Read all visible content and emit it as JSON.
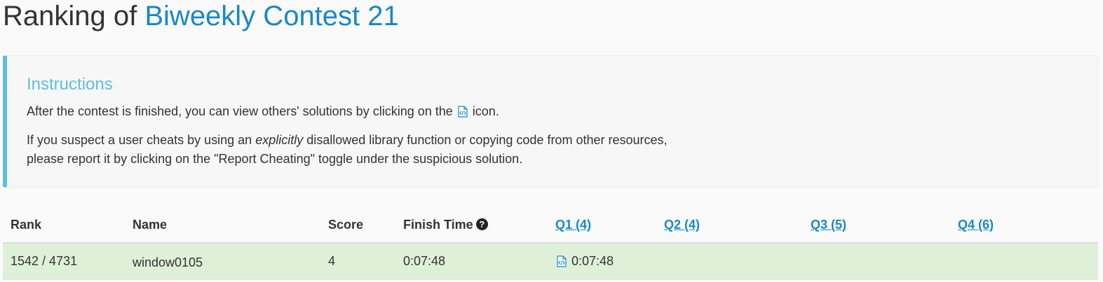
{
  "header": {
    "title_prefix": "Ranking of",
    "contest_name": "Biweekly Contest 21"
  },
  "instructions": {
    "heading": "Instructions",
    "p1_before": "After the contest is finished, you can view others' solutions by clicking on the",
    "p1_after": "icon.",
    "p2_before": "If you suspect a user cheats by using an",
    "p2_emph": "explicitly",
    "p2_after": "disallowed library function or copying code from other resources,",
    "p2_line2": "please report it by clicking on the \"Report Cheating\" toggle under the suspicious solution."
  },
  "table": {
    "columns": {
      "rank": "Rank",
      "name": "Name",
      "score": "Score",
      "finish_time": "Finish Time",
      "q1": "Q1 (4)",
      "q2": "Q2 (4)",
      "q3": "Q3 (5)",
      "q4": "Q4 (6)"
    },
    "rows": [
      {
        "rank": "1542 / 4731",
        "name": "window0105",
        "score": "4",
        "finish_time": "0:07:48",
        "q1": "0:07:48",
        "q2": "",
        "q3": "",
        "q4": ""
      }
    ]
  },
  "icons": {
    "code": "code-file-icon",
    "help": "question-circle-icon"
  },
  "colors": {
    "accent": "#1a87c6",
    "info": "#5bc0de",
    "success_row": "#dff0d8"
  }
}
